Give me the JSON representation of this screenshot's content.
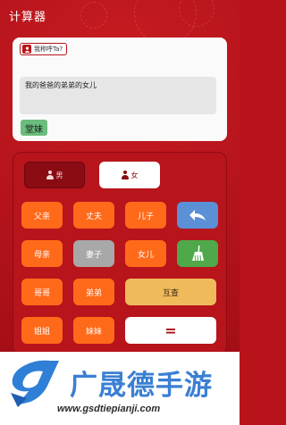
{
  "app": {
    "title": "计算器"
  },
  "prompt": {
    "badge_label": "我称呼Ta?",
    "input_value": "我的爸爸的弟弟的女儿",
    "result": "堂妹"
  },
  "gender": {
    "male_label": "男",
    "female_label": "女"
  },
  "keys": {
    "father": "父亲",
    "husband": "丈夫",
    "son": "儿子",
    "back_icon": "undo-arrow-icon",
    "mother": "母亲",
    "wife": "妻子",
    "daughter": "女儿",
    "clear_icon": "broom-icon",
    "elder_brother": "哥哥",
    "younger_brother": "弟弟",
    "mutual_check": "互查",
    "elder_sister": "姐姐",
    "younger_sister": "妹妹",
    "equals": "="
  },
  "footer": {
    "brand": "广晟德手游",
    "url": "www.gsdtiepianji.com"
  },
  "colors": {
    "background": "#b8131b",
    "key_orange": "#ff6a1a",
    "key_grey": "#a8a8a8",
    "key_blue": "#5b8fd6",
    "key_green": "#4fa84a",
    "key_gold": "#f0b95a",
    "result_green": "#6bbd7d",
    "brand_blue": "#3a7fd3"
  }
}
